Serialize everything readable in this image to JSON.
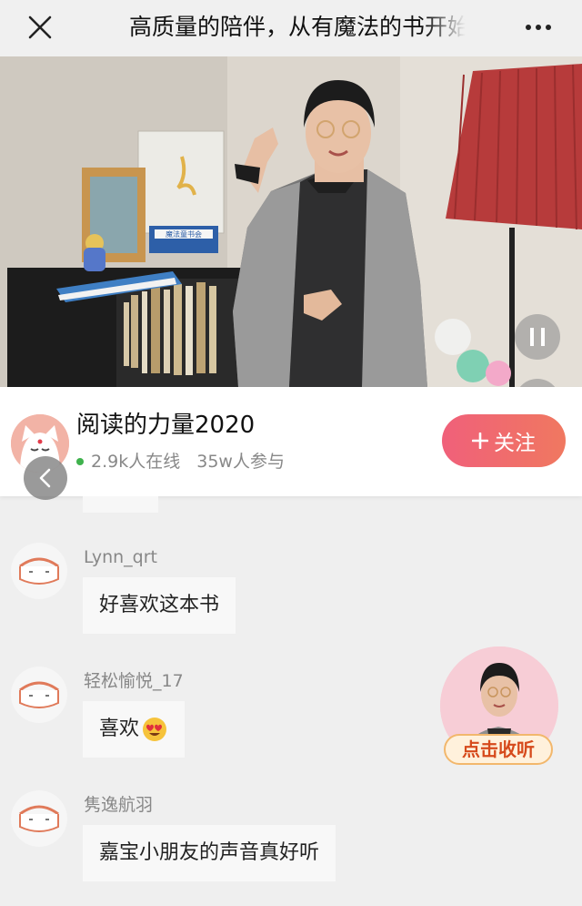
{
  "header": {
    "title": "高质量的陪伴，从有魔法的书开始",
    "close_icon": "close-icon",
    "more_icon": "more-dots-icon"
  },
  "video": {
    "pause_icon": "pause-icon",
    "fullscreen_icon": "fullscreen-icon",
    "book_cover_text": "魔法童书会"
  },
  "room": {
    "title": "阅读的力量2020",
    "online": "2.9k人在线",
    "participants": "35w人参与",
    "follow_label": "关注",
    "follow_icon": "plus-icon",
    "accent": "#f0607a"
  },
  "comments": [
    {
      "user": "Lynn_qrt",
      "text": "好喜欢这本书"
    },
    {
      "user": "轻松愉悦_17",
      "text": "喜欢"
    },
    {
      "user": "隽逸航羽",
      "text": "嘉宝小朋友的声音真好听"
    }
  ],
  "listen_widget": {
    "label": "点击收听"
  }
}
